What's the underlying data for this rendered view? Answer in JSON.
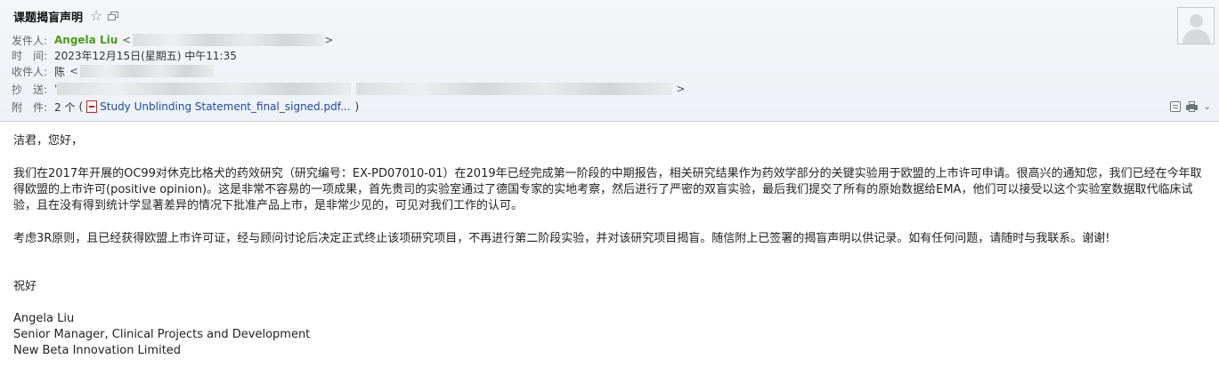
{
  "email": {
    "subject": "课题揭盲声明",
    "from": {
      "label": "发件人:",
      "name": "Angela Liu",
      "open": "<",
      "close": ">"
    },
    "time": {
      "label": "时　间:",
      "value": "2023年12月15日(星期五) 中午11:35"
    },
    "to": {
      "label": "收件人:",
      "name": "陈",
      "open": "<"
    },
    "cc": {
      "label": "抄　送:",
      "open": "'",
      "close": ">"
    },
    "attachments": {
      "label": "附　件:",
      "count": "2 个",
      "open": "(",
      "file": "Study Unblinding Statement_final_signed.pdf...",
      "close": ")"
    }
  },
  "body": {
    "greeting": "洁君，您好，",
    "paragraph1": "我们在2017年开展的OC99对休克比格犬的药效研究（研究编号：EX-PD07010-01）在2019年已经完成第一阶段的中期报告，相关研究结果作为药效学部分的关键实验用于欧盟的上市许可申请。很高兴的通知您，我们已经在今年取得欧盟的上市许可(positive opinion)。这是非常不容易的一项成果，首先贵司的实验室通过了德国专家的实地考察，然后进行了严密的双盲实验，最后我们提交了所有的原始数据给EMA，他们可以接受以这个实验室数据取代临床试验，且在没有得到统计学显著差异的情况下批准产品上市，是非常少见的，可见对我们工作的认可。",
    "paragraph2": "考虑3R原则，且已经获得欧盟上市许可证，经与顾问讨论后决定正式终止该项研究项目，不再进行第二阶段实验，并对该研究项目揭盲。随信附上已签署的揭盲声明以供记录。如有任何问题，请随时与我联系。谢谢!",
    "closing": "祝好",
    "signature": {
      "name": "Angela Liu",
      "title": "Senior Manager, Clinical Projects and Development",
      "company": "New Beta Innovation Limited"
    }
  },
  "icons": {
    "star": "☆",
    "chevron": "⌄"
  },
  "colors": {
    "sender_name": "#4a9a1c",
    "link": "#1f4aa8",
    "header_bg": "#f4f6f9"
  }
}
